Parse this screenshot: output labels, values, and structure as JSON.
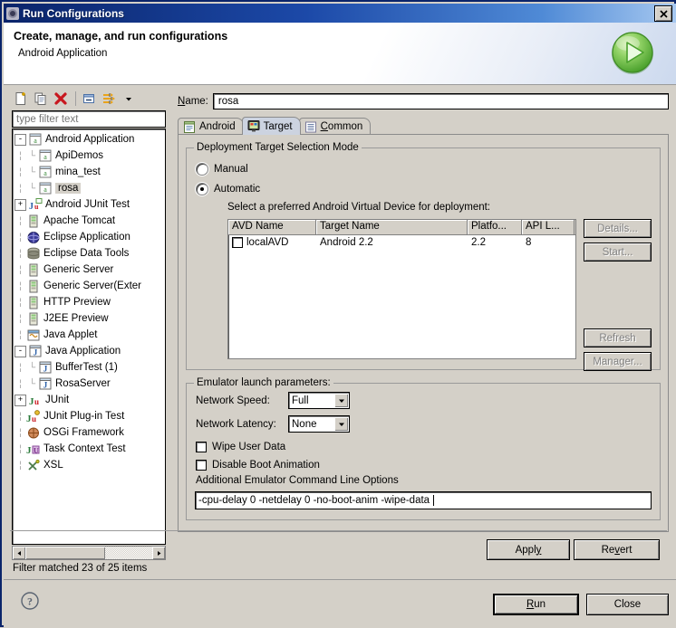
{
  "window": {
    "title": "Run Configurations",
    "icon": "gear-icon",
    "close_label": "✕"
  },
  "header": {
    "title": "Create, manage, and run configurations",
    "subtitle": "Android Application",
    "icon": "run-green-play-icon"
  },
  "toolbar": {
    "buttons": [
      {
        "name": "new-launch-configuration",
        "icon": "new-document-icon"
      },
      {
        "name": "duplicate-launch-configuration",
        "icon": "copy-document-icon"
      },
      {
        "name": "delete-launch-configuration",
        "icon": "delete-red-x-icon"
      },
      {
        "name": "collapse-all",
        "icon": "collapse-all-icon"
      },
      {
        "name": "filter-configurations",
        "icon": "filter-arrows-icon"
      },
      {
        "name": "view-menu",
        "icon": "chevron-down-icon"
      }
    ]
  },
  "filter": {
    "placeholder": "type filter text",
    "value": "",
    "status": "Filter matched 23 of 25 items"
  },
  "tree": {
    "items": [
      {
        "label": "Android Application",
        "icon": "android-app-icon",
        "depth": 0,
        "expander": "-",
        "selected": false
      },
      {
        "label": "ApiDemos",
        "icon": "android-app-icon",
        "depth": 1,
        "expander": "",
        "selected": false
      },
      {
        "label": "mina_test",
        "icon": "android-app-icon",
        "depth": 1,
        "expander": "",
        "selected": false
      },
      {
        "label": "rosa",
        "icon": "android-app-icon",
        "depth": 1,
        "expander": "",
        "selected": true
      },
      {
        "label": "Android JUnit Test",
        "icon": "android-junit-icon",
        "depth": 0,
        "expander": "+",
        "selected": false
      },
      {
        "label": "Apache Tomcat",
        "icon": "server-icon",
        "depth": 0,
        "expander": "",
        "selected": false
      },
      {
        "label": "Eclipse Application",
        "icon": "eclipse-globe-icon",
        "depth": 0,
        "expander": "",
        "selected": false
      },
      {
        "label": "Eclipse Data Tools",
        "icon": "database-icon",
        "depth": 0,
        "expander": "",
        "selected": false
      },
      {
        "label": "Generic Server",
        "icon": "server-icon",
        "depth": 0,
        "expander": "",
        "selected": false
      },
      {
        "label": "Generic Server(Exter",
        "icon": "server-icon",
        "depth": 0,
        "expander": "",
        "selected": false
      },
      {
        "label": "HTTP Preview",
        "icon": "server-icon",
        "depth": 0,
        "expander": "",
        "selected": false
      },
      {
        "label": "J2EE Preview",
        "icon": "server-icon",
        "depth": 0,
        "expander": "",
        "selected": false
      },
      {
        "label": "Java Applet",
        "icon": "java-applet-icon",
        "depth": 0,
        "expander": "",
        "selected": false
      },
      {
        "label": "Java Application",
        "icon": "java-app-icon",
        "depth": 0,
        "expander": "-",
        "selected": false
      },
      {
        "label": "BufferTest (1)",
        "icon": "java-app-icon",
        "depth": 1,
        "expander": "",
        "selected": false
      },
      {
        "label": "RosaServer",
        "icon": "java-app-icon",
        "depth": 1,
        "expander": "",
        "selected": false
      },
      {
        "label": "JUnit",
        "icon": "junit-icon",
        "depth": 0,
        "expander": "+",
        "selected": false
      },
      {
        "label": "JUnit Plug-in Test",
        "icon": "junit-plugin-icon",
        "depth": 0,
        "expander": "",
        "selected": false
      },
      {
        "label": "OSGi Framework",
        "icon": "osgi-icon",
        "depth": 0,
        "expander": "",
        "selected": false
      },
      {
        "label": "Task Context Test",
        "icon": "task-context-icon",
        "depth": 0,
        "expander": "",
        "selected": false
      },
      {
        "label": "XSL",
        "icon": "xsl-icon",
        "depth": 0,
        "expander": "",
        "selected": false
      }
    ]
  },
  "name_field": {
    "label": "Name:",
    "mnemonic": "N",
    "value": "rosa"
  },
  "tabs": [
    {
      "label": "Android",
      "icon": "android-tab-icon",
      "active": false,
      "mnemonic": ""
    },
    {
      "label": "Target",
      "icon": "target-monitor-icon",
      "active": true,
      "mnemonic": ""
    },
    {
      "label": "Common",
      "icon": "common-list-icon",
      "active": false,
      "mnemonic": "C"
    }
  ],
  "target_tab": {
    "deployment_group": {
      "title": "Deployment Target Selection Mode",
      "options": [
        {
          "label": "Manual",
          "selected": false
        },
        {
          "label": "Automatic",
          "selected": true
        }
      ],
      "avd_prompt": "Select a preferred Android Virtual Device for deployment:",
      "table": {
        "columns": [
          "AVD Name",
          "Target Name",
          "Platfo...",
          "API L..."
        ],
        "rows": [
          {
            "checked": false,
            "avd_name": "localAVD",
            "target_name": "Android 2.2",
            "platform": "2.2",
            "api_level": "8"
          }
        ]
      },
      "side_buttons": [
        {
          "label": "Details...",
          "enabled": false
        },
        {
          "label": "Start...",
          "enabled": false
        },
        {
          "label": "Refresh",
          "enabled": false
        },
        {
          "label": "Manager...",
          "enabled": false
        }
      ]
    },
    "emulator_group": {
      "title": "Emulator launch parameters:",
      "network_speed": {
        "label": "Network Speed:",
        "value": "Full"
      },
      "network_latency": {
        "label": "Network Latency:",
        "value": "None"
      },
      "checkboxes": [
        {
          "label": "Wipe User Data",
          "checked": false
        },
        {
          "label": "Disable Boot Animation",
          "checked": false
        }
      ],
      "additional_options": {
        "label": "Additional Emulator Command Line Options",
        "value": "-cpu-delay 0 -netdelay 0 -no-boot-anim -wipe-data "
      }
    }
  },
  "action_buttons": {
    "apply": {
      "label": "Apply",
      "mnemonic": "y"
    },
    "revert": {
      "label": "Revert",
      "mnemonic": "v"
    }
  },
  "bottom_buttons": {
    "help": {
      "icon": "help-question-icon"
    },
    "run": {
      "label": "Run",
      "mnemonic": "R",
      "default": true
    },
    "close": {
      "label": "Close",
      "default": false
    }
  }
}
